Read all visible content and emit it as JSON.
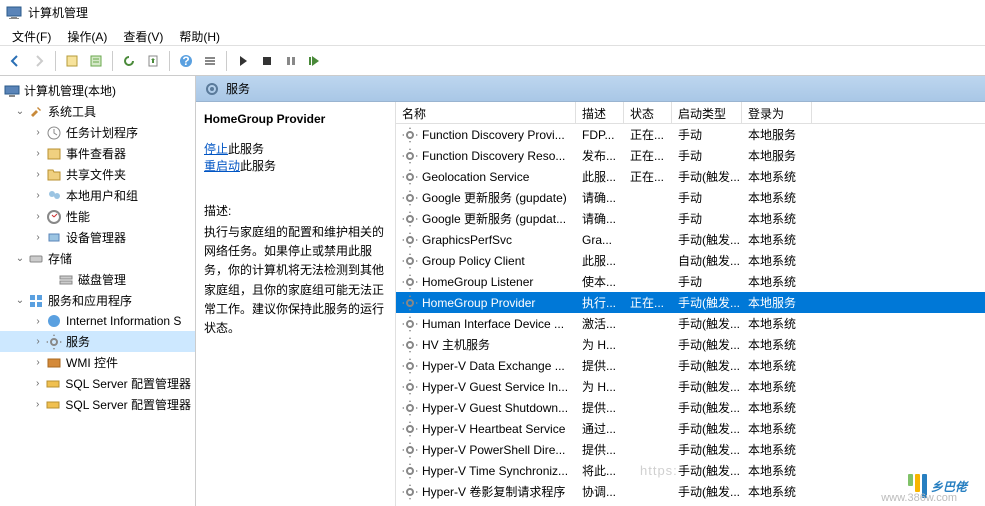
{
  "titlebar": {
    "title": "计算机管理"
  },
  "menu": {
    "file": "文件(F)",
    "action": "操作(A)",
    "view": "查看(V)",
    "help": "帮助(H)"
  },
  "tree": {
    "root": "计算机管理(本地)",
    "sys_tools": "系统工具",
    "sys_children": [
      "任务计划程序",
      "事件查看器",
      "共享文件夹",
      "本地用户和组",
      "性能",
      "设备管理器"
    ],
    "storage": "存储",
    "storage_children": [
      "磁盘管理"
    ],
    "svc_apps": "服务和应用程序",
    "svc_children": [
      "Internet Information S",
      "服务",
      "WMI 控件",
      "SQL Server 配置管理器",
      "SQL Server 配置管理器"
    ]
  },
  "right_header": {
    "title": "服务"
  },
  "detail": {
    "name": "HomeGroup Provider",
    "stop_link": "停止",
    "stop_rest": "此服务",
    "restart_link": "重启动",
    "restart_rest": "此服务",
    "desc_label": "描述:",
    "desc": "执行与家庭组的配置和维护相关的网络任务。如果停止或禁用此服务，你的计算机将无法检测到其他家庭组，且你的家庭组可能无法正常工作。建议你保持此服务的运行状态。"
  },
  "cols": [
    "名称",
    "描述",
    "状态",
    "启动类型",
    "登录为"
  ],
  "rows": [
    {
      "n": "Function Discovery Provi...",
      "d": "FDP...",
      "s": "正在...",
      "t": "手动",
      "l": "本地服务"
    },
    {
      "n": "Function Discovery Reso...",
      "d": "发布...",
      "s": "正在...",
      "t": "手动",
      "l": "本地服务"
    },
    {
      "n": "Geolocation Service",
      "d": "此服...",
      "s": "正在...",
      "t": "手动(触发...",
      "l": "本地系统"
    },
    {
      "n": "Google 更新服务 (gupdate)",
      "d": "请确...",
      "s": "",
      "t": "手动",
      "l": "本地系统"
    },
    {
      "n": "Google 更新服务 (gupdat...",
      "d": "请确...",
      "s": "",
      "t": "手动",
      "l": "本地系统"
    },
    {
      "n": "GraphicsPerfSvc",
      "d": "Gra...",
      "s": "",
      "t": "手动(触发...",
      "l": "本地系统"
    },
    {
      "n": "Group Policy Client",
      "d": "此服...",
      "s": "",
      "t": "自动(触发...",
      "l": "本地系统"
    },
    {
      "n": "HomeGroup Listener",
      "d": "使本...",
      "s": "",
      "t": "手动",
      "l": "本地系统"
    },
    {
      "n": "HomeGroup Provider",
      "d": "执行...",
      "s": "正在...",
      "t": "手动(触发...",
      "l": "本地服务",
      "sel": true
    },
    {
      "n": "Human Interface Device ...",
      "d": "激活...",
      "s": "",
      "t": "手动(触发...",
      "l": "本地系统"
    },
    {
      "n": "HV 主机服务",
      "d": "为 H...",
      "s": "",
      "t": "手动(触发...",
      "l": "本地系统"
    },
    {
      "n": "Hyper-V Data Exchange ...",
      "d": "提供...",
      "s": "",
      "t": "手动(触发...",
      "l": "本地系统"
    },
    {
      "n": "Hyper-V Guest Service In...",
      "d": "为 H...",
      "s": "",
      "t": "手动(触发...",
      "l": "本地系统"
    },
    {
      "n": "Hyper-V Guest Shutdown...",
      "d": "提供...",
      "s": "",
      "t": "手动(触发...",
      "l": "本地系统"
    },
    {
      "n": "Hyper-V Heartbeat Service",
      "d": "通过...",
      "s": "",
      "t": "手动(触发...",
      "l": "本地系统"
    },
    {
      "n": "Hyper-V PowerShell Dire...",
      "d": "提供...",
      "s": "",
      "t": "手动(触发...",
      "l": "本地系统"
    },
    {
      "n": "Hyper-V Time Synchroniz...",
      "d": "将此...",
      "s": "",
      "t": "手动(触发...",
      "l": "本地系统"
    },
    {
      "n": "Hyper-V 卷影复制请求程序",
      "d": "协调...",
      "s": "",
      "t": "手动(触发...",
      "l": "本地系统"
    }
  ],
  "watermark": {
    "text": "乡巴佬",
    "url": "www.386w.com",
    "ghost": "https:"
  }
}
